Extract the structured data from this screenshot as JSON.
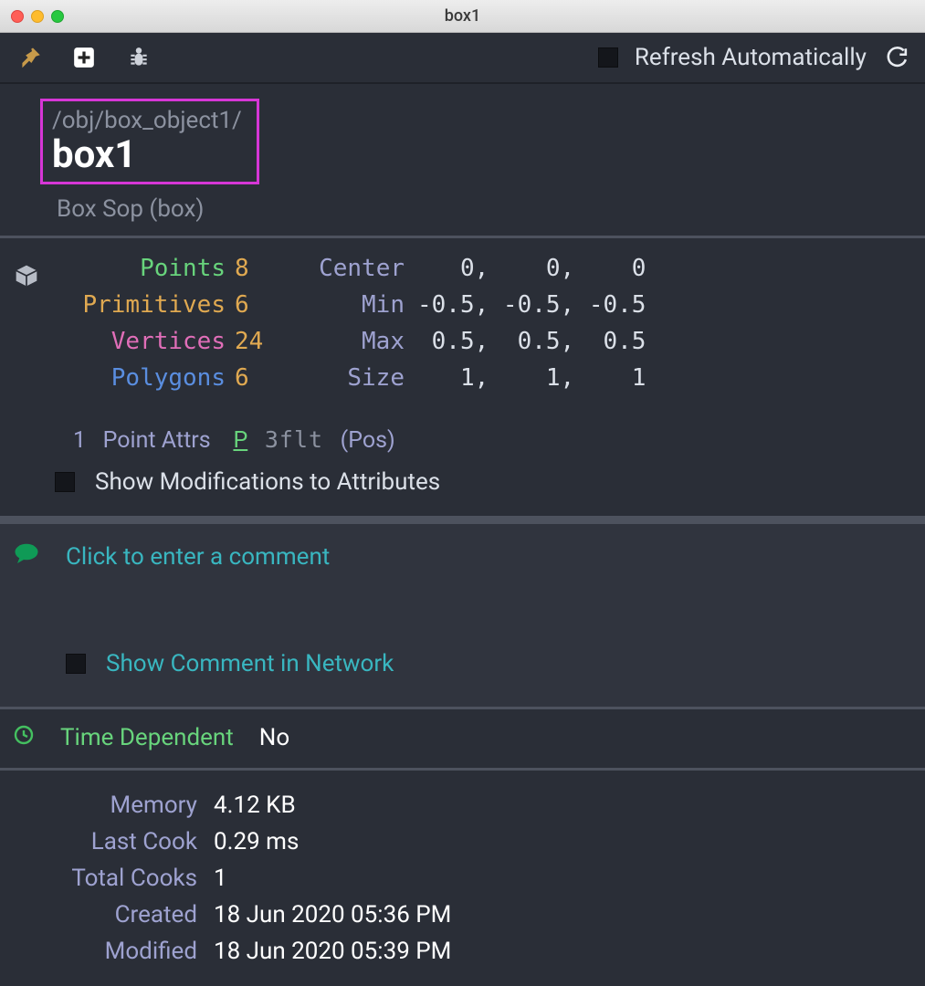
{
  "window": {
    "title": "box1"
  },
  "toolbar": {
    "refresh_label": "Refresh Automatically"
  },
  "header": {
    "path": "/obj/box_object1/",
    "name": "box1",
    "type": "Box Sop (box)"
  },
  "geo": {
    "points_label": "Points",
    "points": "8",
    "prims_label": "Primitives",
    "prims": "6",
    "verts_label": "Vertices",
    "verts": "24",
    "polys_label": "Polygons",
    "polys": "6",
    "center_label": "Center",
    "center": "   0,    0,    0",
    "min_label": "Min",
    "min": "-0.5, -0.5, -0.5",
    "max_label": "Max",
    "max": " 0.5,  0.5,  0.5",
    "size_label": "Size",
    "size": "   1,    1,    1"
  },
  "attrs": {
    "count": "1",
    "label": "Point Attrs",
    "p": "P",
    "flt": "3flt",
    "pos": "(Pos)"
  },
  "show_mod_label": "Show Modifications to Attributes",
  "comment": {
    "placeholder": "Click to enter a comment",
    "show_net_label": "Show Comment in Network"
  },
  "timedep": {
    "label": "Time Dependent",
    "value": "No"
  },
  "info": {
    "memory_label": "Memory",
    "memory": "4.12 KB",
    "lastcook_label": "Last Cook",
    "lastcook": "0.29 ms",
    "totalcooks_label": "Total Cooks",
    "totalcooks": "1",
    "created_label": "Created",
    "created": "18 Jun 2020 05:36 PM",
    "modified_label": "Modified",
    "modified": "18 Jun 2020 05:39 PM"
  }
}
